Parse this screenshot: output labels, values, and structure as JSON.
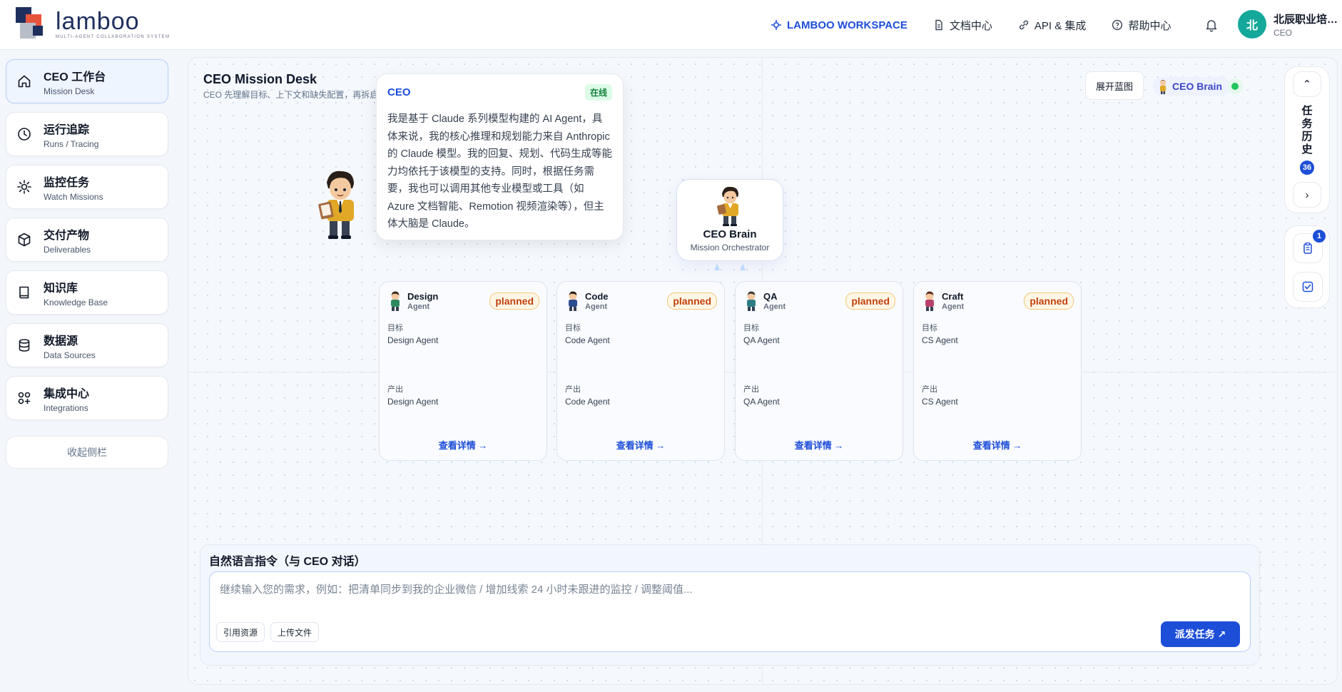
{
  "brand": {
    "word": "lamboo",
    "tagline": "MULTI-AGENT COLLABORATION SYSTEM"
  },
  "nav": [
    {
      "label": "LAMBOO WORKSPACE",
      "icon": "sparkle-icon",
      "active": true
    },
    {
      "label": "文档中心",
      "icon": "document-icon"
    },
    {
      "label": "API & 集成",
      "icon": "link-icon"
    },
    {
      "label": "帮助中心",
      "icon": "help-icon"
    }
  ],
  "user": {
    "initial": "北",
    "name": "北辰职业培训学校",
    "role": "CEO"
  },
  "sidebar": {
    "items": [
      {
        "title": "CEO 工作台",
        "subtitle": "Mission Desk",
        "icon": "home-icon",
        "active": true
      },
      {
        "title": "运行追踪",
        "subtitle": "Runs / Tracing",
        "icon": "clock-icon"
      },
      {
        "title": "监控任务",
        "subtitle": "Watch Missions",
        "icon": "sun-icon"
      },
      {
        "title": "交付产物",
        "subtitle": "Deliverables",
        "icon": "box-icon"
      },
      {
        "title": "知识库",
        "subtitle": "Knowledge Base",
        "icon": "book-icon"
      },
      {
        "title": "数据源",
        "subtitle": "Data Sources",
        "icon": "database-icon"
      },
      {
        "title": "集成中心",
        "subtitle": "Integrations",
        "icon": "grid-icon"
      }
    ],
    "collapse_label": "收起侧栏"
  },
  "desk": {
    "title": "CEO Mission Desk",
    "subtitle": "CEO 先理解目标、上下文和缺失配置，再拆启",
    "expand_label": "展开蓝图",
    "brain_pill": "CEO Brain"
  },
  "speech": {
    "name": "CEO",
    "status": "在线",
    "text": "我是基于 Claude 系列模型构建的 AI Agent，具体来说，我的核心推理和规划能力来自 Anthropic 的 Claude 模型。我的回复、规划、代码生成等能力均依托于该模型的支持。同时，根据任务需要，我也可以调用其他专业模型或工具（如 Azure 文档智能、Remotion 视频渲染等），但主体大脑是 Claude。"
  },
  "brain_node": {
    "title": "CEO Brain",
    "subtitle": "Mission Orchestrator"
  },
  "agents": [
    {
      "name": "Design",
      "role": "Agent",
      "status": "planned",
      "goal_label": "目标",
      "goal": "Design Agent",
      "output_label": "产出",
      "output": "Design Agent",
      "link": "查看详情 →",
      "colors": {
        "shirt": "#2d8a5f",
        "hair": "#3b2a1e"
      }
    },
    {
      "name": "Code",
      "role": "Agent",
      "status": "planned",
      "goal_label": "目标",
      "goal": "Code Agent",
      "output_label": "产出",
      "output": "Code Agent",
      "link": "查看详情 →",
      "colors": {
        "shirt": "#2b4c8f",
        "hair": "#2a1f18"
      }
    },
    {
      "name": "QA",
      "role": "Agent",
      "status": "planned",
      "goal_label": "目标",
      "goal": "QA Agent",
      "output_label": "产出",
      "output": "QA Agent",
      "link": "查看详情 →",
      "colors": {
        "shirt": "#2f7e86",
        "hair": "#3a3a3a"
      }
    },
    {
      "name": "Craft",
      "role": "Agent",
      "status": "planned",
      "goal_label": "目标",
      "goal": "CS Agent",
      "output_label": "产出",
      "output": "CS Agent",
      "link": "查看详情 →",
      "colors": {
        "shirt": "#b8426b",
        "hair": "#5a2a1e"
      }
    }
  ],
  "history": {
    "collapse_glyph": "⌃",
    "title": "任务历史",
    "count": "36",
    "next_glyph": "›"
  },
  "rail": {
    "clipboard_badge": "1"
  },
  "command": {
    "title": "自然语言指令（与 CEO 对话）",
    "placeholder": "继续输入您的需求，例如：把清单同步到我的企业微信 / 增加线索 24 小时未跟进的监控 / 调整阈值...",
    "chip_resource": "引用资源",
    "chip_upload": "上传文件",
    "dispatch_label": "派发任务 ↗"
  },
  "colors": {
    "accent": "#1d4ed8",
    "online": "#22c55e",
    "planned": "#c2410c",
    "avatar": "#14a89a"
  }
}
